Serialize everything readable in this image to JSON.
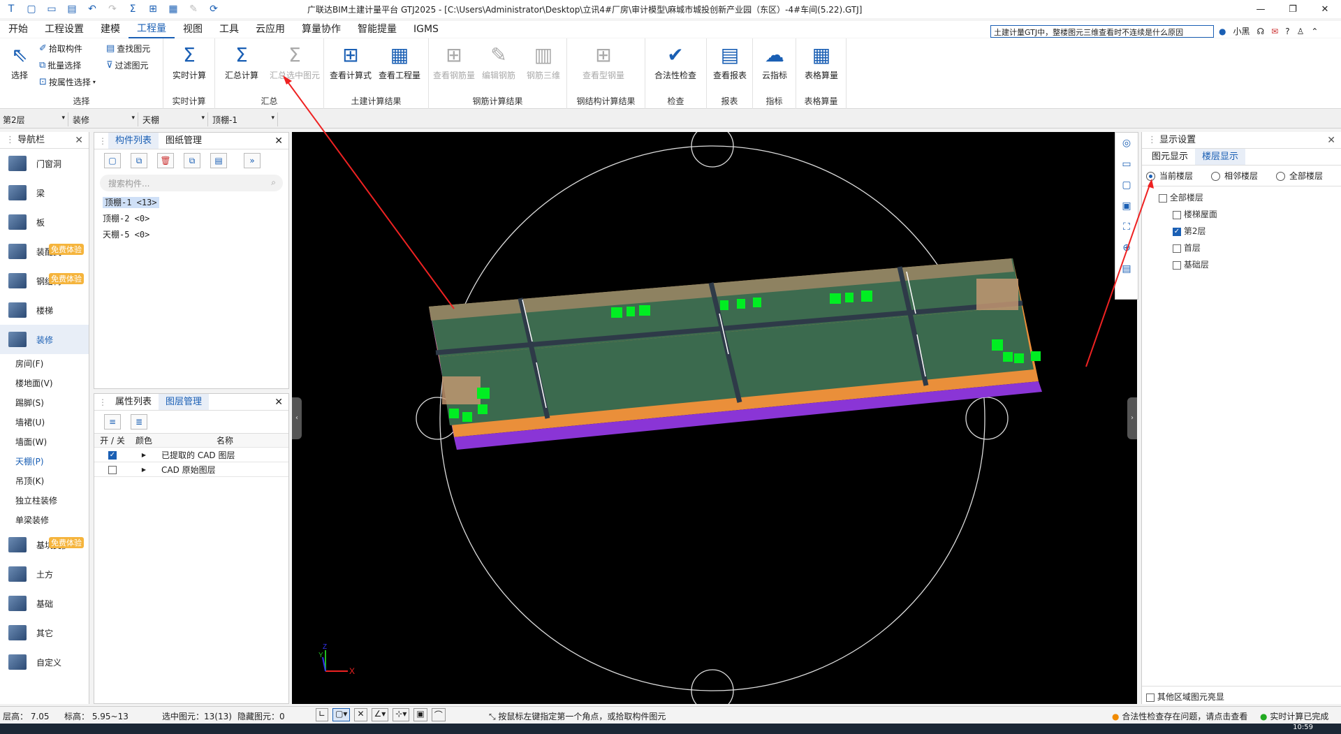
{
  "window": {
    "title": "广联达BIM土建计量平台 GTJ2025 - [C:\\Users\\Administrator\\Desktop\\立讯4#厂房\\审计模型\\麻城市城投创新产业园（东区）-4#车间(5.22).GTJ]",
    "controls": [
      "—",
      "❐",
      "✕"
    ]
  },
  "menu": {
    "items": [
      "开始",
      "工程设置",
      "建模",
      "工程量",
      "视图",
      "工具",
      "云应用",
      "算量协作",
      "智能提量",
      "IGMS"
    ],
    "active": "工程量",
    "help_search": "土建计量GTJ中，整楼图元三维查看时不连续是什么原因",
    "user": "小黑"
  },
  "ribbon": {
    "select": {
      "label": "选择",
      "big": "选择",
      "small": [
        "拾取构件",
        "批量选择",
        "按属性选择",
        "查找图元",
        "过滤图元"
      ]
    },
    "realtime": {
      "label": "实时计算",
      "btn": "实时计算"
    },
    "summary": {
      "label": "汇总",
      "btns": [
        "汇总计算",
        "汇总选中图元"
      ]
    },
    "civil_result": {
      "label": "土建计算结果",
      "btns": [
        "查看计算式",
        "查看工程量"
      ]
    },
    "rebar_result": {
      "label": "钢筋计算结果",
      "btns": [
        "查看钢筋量",
        "编辑钢筋",
        "钢筋三维"
      ]
    },
    "steel_result": {
      "label": "钢结构计算结果",
      "btns": [
        "查看型钢量"
      ]
    },
    "check": {
      "label": "检查",
      "btn": "合法性检查"
    },
    "report": {
      "label": "报表",
      "btn": "查看报表"
    },
    "index": {
      "label": "指标",
      "btn": "云指标"
    },
    "table": {
      "label": "表格算量",
      "btn": "表格算量"
    }
  },
  "selectors": [
    "第2层",
    "装修",
    "天棚",
    "顶棚-1"
  ],
  "nav": {
    "title": "导航栏",
    "categories": [
      {
        "label": "门窗洞"
      },
      {
        "label": "梁"
      },
      {
        "label": "板"
      },
      {
        "label": "装配式",
        "badge": "免费体验"
      },
      {
        "label": "钢结构",
        "badge": "免费体验"
      },
      {
        "label": "楼梯"
      },
      {
        "label": "装修"
      }
    ],
    "sub": [
      "房间(F)",
      "楼地面(V)",
      "踢脚(S)",
      "墙裙(U)",
      "墙面(W)",
      "天棚(P)",
      "吊顶(K)",
      "独立柱装修",
      "单梁装修"
    ],
    "active_sub": "天棚(P)",
    "categories2": [
      {
        "label": "基坑支护",
        "badge": "免费体验"
      },
      {
        "label": "土方"
      },
      {
        "label": "基础"
      },
      {
        "label": "其它"
      },
      {
        "label": "自定义"
      }
    ]
  },
  "component_panel": {
    "tabs": [
      "构件列表",
      "图纸管理"
    ],
    "search_placeholder": "搜索构件...",
    "items": [
      "顶棚-1 <13>",
      "顶棚-2 <0>",
      "天棚-5 <0>"
    ]
  },
  "layer_panel": {
    "tabs": [
      "属性列表",
      "图层管理"
    ],
    "headers": [
      "开 / 关",
      "颜色",
      "名称"
    ],
    "rows": [
      {
        "on": true,
        "name": "已提取的 CAD 图层"
      },
      {
        "on": false,
        "name": "CAD 原始图层"
      }
    ]
  },
  "display_panel": {
    "title": "显示设置",
    "tabs": [
      "图元显示",
      "楼层显示"
    ],
    "radios": [
      "当前楼层",
      "相邻楼层",
      "全部楼层"
    ],
    "tree_root": "全部楼层",
    "floors": [
      {
        "name": "楼梯屋面",
        "checked": false
      },
      {
        "name": "第2层",
        "checked": true
      },
      {
        "name": "首层",
        "checked": false
      },
      {
        "name": "基础层",
        "checked": false
      }
    ],
    "footer": "其他区域图元亮显"
  },
  "viewport": {
    "axis_x": "X",
    "axis_y": "Y",
    "axis_z": "Z"
  },
  "status": {
    "floor_height": "层高：   7.05",
    "elevation": "标高：   5.95~13",
    "selected": "选中图元：13(13)",
    "hidden": "隐藏图元：0",
    "hint": "按鼠标左键指定第一个角点，或拾取构件图元",
    "check_msg": "合法性检查存在问题，请点击查看",
    "calc_msg": "实时计算已完成",
    "time": "10:59"
  },
  "colors": {
    "accent": "#1a5fb4",
    "badge": "#f5b43c",
    "slab": "#3d6b4f",
    "wall": "#e8873a",
    "marker": "#00ee22"
  }
}
